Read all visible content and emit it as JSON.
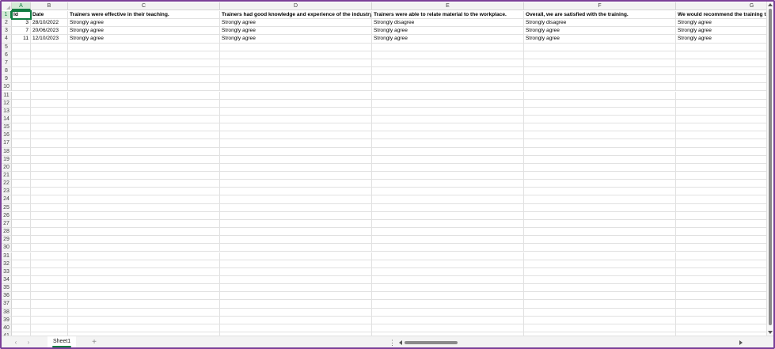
{
  "columns": [
    "A",
    "B",
    "C",
    "D",
    "E",
    "F",
    "G"
  ],
  "row_numbers": [
    "1",
    "2",
    "3",
    "4",
    "5",
    "6",
    "7",
    "8",
    "9",
    "10",
    "11",
    "12",
    "13",
    "14",
    "15",
    "16",
    "17",
    "18",
    "19",
    "20",
    "21",
    "22",
    "23",
    "24",
    "25",
    "26",
    "27",
    "28",
    "29",
    "30",
    "31",
    "32",
    "33",
    "34",
    "35",
    "36",
    "37",
    "38",
    "39",
    "40",
    "41"
  ],
  "rows": [
    [
      "Id",
      "Date",
      "Trainers were effective in their teaching.",
      "Trainers had good knowledge and experience of the industry",
      "Trainers were able to relate material to the workplace.",
      "Overall, we are satisfied with the training.",
      "We would recommend the training t"
    ],
    [
      "3",
      "28/10/2022",
      "Strongly agree",
      "Strongly agree",
      "Strongly disagree",
      "Strongly disagree",
      "Strongly agree"
    ],
    [
      "7",
      "20/06/2023",
      "Strongly agree",
      "Strongly agree",
      "Strongly agree",
      "Strongly agree",
      "Strongly agree"
    ],
    [
      "11",
      "12/10/2023",
      "Strongly agree",
      "Strongly agree",
      "Strongly agree",
      "Strongly agree",
      "Strongly agree"
    ]
  ],
  "sheet_tabs": [
    "Sheet1"
  ],
  "active_cell": "A1",
  "icons": {
    "prev_sheet": "‹",
    "next_sheet": "›",
    "add_sheet": "+",
    "more_options": "⋮"
  },
  "colors": {
    "accent": "#107c41",
    "frame": "#7b3f98",
    "header_bg": "#f3f3f3",
    "gridline": "#e1e1e1"
  }
}
